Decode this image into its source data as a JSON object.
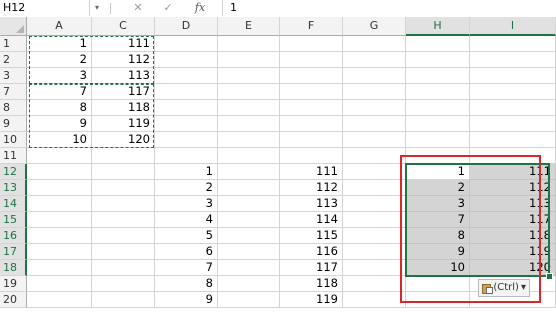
{
  "formula_bar": {
    "name_box": "H12",
    "name_box_arrow": "▾",
    "cancel_icon": "✕",
    "enter_icon": "✓",
    "fx_label": "fx",
    "formula_value": "1"
  },
  "columns": [
    {
      "label": "A",
      "selected": false
    },
    {
      "label": "C",
      "selected": false
    },
    {
      "label": "D",
      "selected": false
    },
    {
      "label": "E",
      "selected": false
    },
    {
      "label": "F",
      "selected": false
    },
    {
      "label": "G",
      "selected": false
    },
    {
      "label": "H",
      "selected": true
    },
    {
      "label": "I",
      "selected": true
    }
  ],
  "rows": [
    {
      "label": "1",
      "selected": false,
      "cells": [
        "1",
        "111",
        "",
        "",
        "",
        "",
        "",
        ""
      ]
    },
    {
      "label": "2",
      "selected": false,
      "cells": [
        "2",
        "112",
        "",
        "",
        "",
        "",
        "",
        ""
      ]
    },
    {
      "label": "3",
      "selected": false,
      "cells": [
        "3",
        "113",
        "",
        "",
        "",
        "",
        "",
        ""
      ]
    },
    {
      "label": "7",
      "selected": false,
      "cells": [
        "7",
        "117",
        "",
        "",
        "",
        "",
        "",
        ""
      ]
    },
    {
      "label": "8",
      "selected": false,
      "cells": [
        "8",
        "118",
        "",
        "",
        "",
        "",
        "",
        ""
      ]
    },
    {
      "label": "9",
      "selected": false,
      "cells": [
        "9",
        "119",
        "",
        "",
        "",
        "",
        "",
        ""
      ]
    },
    {
      "label": "10",
      "selected": false,
      "cells": [
        "10",
        "120",
        "",
        "",
        "",
        "",
        "",
        ""
      ]
    },
    {
      "label": "11",
      "selected": false,
      "cells": [
        "",
        "",
        "",
        "",
        "",
        "",
        "",
        ""
      ]
    },
    {
      "label": "12",
      "selected": true,
      "cells": [
        "",
        "",
        "1",
        "",
        "111",
        "",
        "1",
        "111"
      ]
    },
    {
      "label": "13",
      "selected": true,
      "cells": [
        "",
        "",
        "2",
        "",
        "112",
        "",
        "2",
        "112"
      ]
    },
    {
      "label": "14",
      "selected": true,
      "cells": [
        "",
        "",
        "3",
        "",
        "113",
        "",
        "3",
        "113"
      ]
    },
    {
      "label": "15",
      "selected": true,
      "cells": [
        "",
        "",
        "4",
        "",
        "114",
        "",
        "7",
        "117"
      ]
    },
    {
      "label": "16",
      "selected": true,
      "cells": [
        "",
        "",
        "5",
        "",
        "115",
        "",
        "8",
        "118"
      ]
    },
    {
      "label": "17",
      "selected": true,
      "cells": [
        "",
        "",
        "6",
        "",
        "116",
        "",
        "9",
        "119"
      ]
    },
    {
      "label": "18",
      "selected": true,
      "cells": [
        "",
        "",
        "7",
        "",
        "117",
        "",
        "10",
        "120"
      ]
    },
    {
      "label": "19",
      "selected": false,
      "cells": [
        "",
        "",
        "8",
        "",
        "118",
        "",
        "",
        ""
      ]
    },
    {
      "label": "20",
      "selected": false,
      "cells": [
        "",
        "",
        "9",
        "",
        "119",
        "",
        "",
        ""
      ]
    }
  ],
  "paste_options": {
    "label": "(Ctrl)",
    "arrow": "▾",
    "icon": "clipboard-icon"
  },
  "colors": {
    "accent": "#217346",
    "highlight_box": "#d9262b",
    "selection_fill": "#d4d4d4"
  }
}
